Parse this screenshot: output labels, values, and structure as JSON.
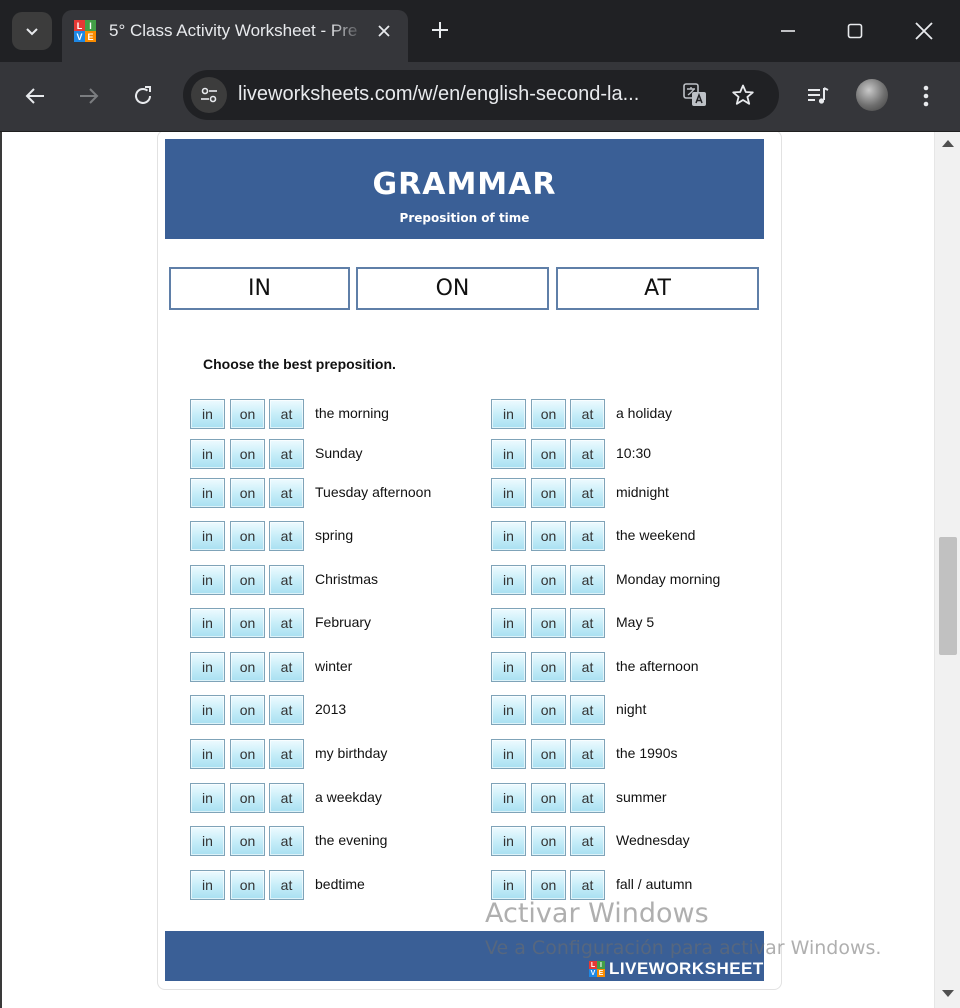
{
  "browser": {
    "tab_title": "5° Class Activity Worksheet - Pre",
    "url": "liveworksheets.com/w/en/english-second-la...",
    "favicon_letters": [
      "L",
      "I",
      "V",
      "E"
    ]
  },
  "worksheet": {
    "title": "GRAMMAR",
    "subtitle": "Preposition of time",
    "prepositions": [
      "IN",
      "ON",
      "AT"
    ],
    "instruction": "Choose the best preposition.",
    "options": [
      "in",
      "on",
      "at"
    ],
    "left_phrases": [
      "the morning",
      "Sunday",
      "Tuesday afternoon",
      "spring",
      "Christmas",
      "February",
      "winter",
      "2013",
      "my birthday",
      "a weekday",
      "the evening",
      "bedtime"
    ],
    "right_phrases": [
      "a holiday",
      "10:30",
      "midnight",
      "the weekend",
      "Monday morning",
      "May 5",
      "the afternoon",
      "night",
      "the 1990s",
      "summer",
      "Wednesday",
      "fall / autumn"
    ],
    "footer_brand": "LIVEWORKSHEETS"
  },
  "watermark": {
    "line1": "Activar Windows",
    "line2": "Ve a Configuración para activar Windows."
  },
  "colors": {
    "banner": "#3a5f96",
    "chrome_dark": "#202124",
    "chrome_toolbar": "#35363a"
  }
}
